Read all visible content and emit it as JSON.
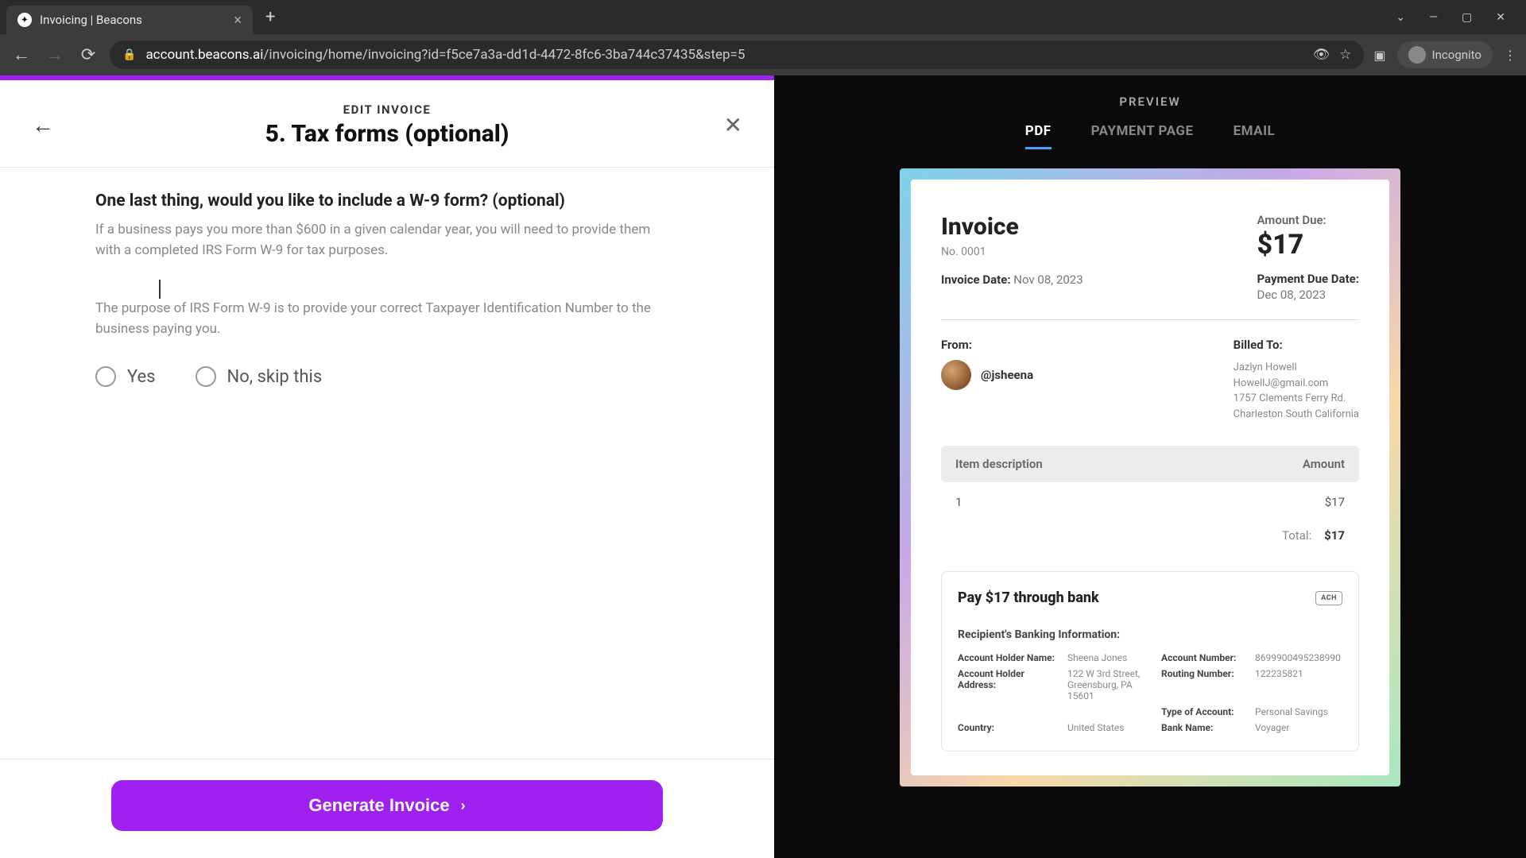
{
  "browser": {
    "tab_title": "Invoicing | Beacons",
    "url_domain": "account.beacons.ai",
    "url_path": "/invoicing/home/invoicing?id=f5ce7a3a-dd1d-4472-8fc6-3ba744c37435&step=5",
    "incognito_label": "Incognito"
  },
  "panel": {
    "eyebrow": "EDIT INVOICE",
    "title": "5. Tax forms (optional)",
    "question": "One last thing, would you like to include a W-9 form? (optional)",
    "helper1": "If a business pays you more than $600 in a given calendar year, you will need to provide them with a completed IRS Form W-9 for tax purposes.",
    "helper2": "The purpose of IRS Form W-9 is to provide your correct Taxpayer Identification Number to the business paying you.",
    "radio_yes": "Yes",
    "radio_no": "No, skip this",
    "cta": "Generate Invoice"
  },
  "preview": {
    "label": "PREVIEW",
    "tabs": {
      "pdf": "PDF",
      "payment": "PAYMENT PAGE",
      "email": "EMAIL"
    }
  },
  "invoice": {
    "title": "Invoice",
    "no_label": "No. 0001",
    "date_label": "Invoice Date:",
    "date_value": "Nov 08, 2023",
    "amount_due_label": "Amount Due:",
    "amount_due_value": "$17",
    "payment_due_label": "Payment Due Date:",
    "payment_due_value": "Dec 08, 2023",
    "from_label": "From:",
    "from_handle": "@jsheena",
    "billed_label": "Billed To:",
    "billed_name": "Jazlyn Howell",
    "billed_email": "HowellJ@gmail.com",
    "billed_addr1": "1757 Clements Ferry Rd.",
    "billed_addr2": "Charleston South California",
    "col_desc": "Item description",
    "col_amt": "Amount",
    "row_desc": "1",
    "row_amt": "$17",
    "total_label": "Total:",
    "total_value": "$17",
    "bank_title": "Pay $17 through bank",
    "ach": "ACH",
    "bank_sub": "Recipient's Banking Information:",
    "acct_holder_name_lbl": "Account Holder Name:",
    "acct_holder_name_val": "Sheena Jones",
    "acct_number_lbl": "Account Number:",
    "acct_number_val": "8699900495238990",
    "acct_holder_addr_lbl": "Account Holder Address:",
    "acct_holder_addr_val": "122 W 3rd Street, Greensburg, PA 15601",
    "routing_lbl": "Routing Number:",
    "routing_val": "122235821",
    "type_acct_lbl": "Type of Account:",
    "type_acct_val": "Personal Savings",
    "country_lbl": "Country:",
    "country_val": "United States",
    "bank_name_lbl": "Bank Name:",
    "bank_name_val": "Voyager"
  }
}
